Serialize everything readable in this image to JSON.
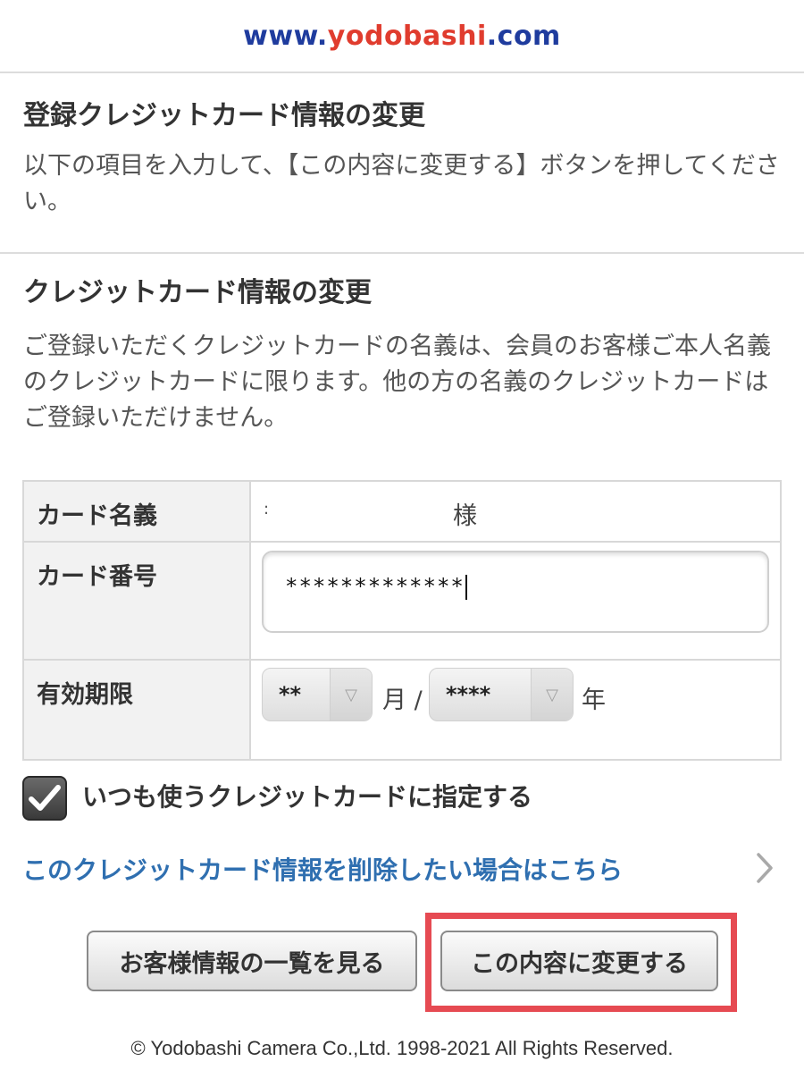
{
  "header": {
    "logo_www": "www.",
    "logo_brand": "yodobashi",
    "logo_com": ".com"
  },
  "page": {
    "title": "登録クレジットカード情報の変更",
    "instruction": "以下の項目を入力して、【この内容に変更する】ボタンを押してください。"
  },
  "section": {
    "title": "クレジットカード情報の変更",
    "notice": "ご登録いただくクレジットカードの名義は、会員のお客様ご本人名義のクレジットカードに限ります。他の方の名義のクレジットカードはご登録いただけません。"
  },
  "form": {
    "card_holder_label": "カード名義",
    "card_holder_colon": ":",
    "card_holder_suffix": "様",
    "card_number_label": "カード番号",
    "card_number_value": "*************",
    "expiry_label": "有効期限",
    "expiry_month_value": "**",
    "expiry_month_unit": "月 /",
    "expiry_year_value": "****",
    "expiry_year_unit": "年"
  },
  "default_card": {
    "label": "いつも使うクレジットカードに指定する",
    "checked": true
  },
  "delete_link": "このクレジットカード情報を削除したい場合はこちら",
  "buttons": {
    "list_label": "お客様情報の一覧を見る",
    "change_label": "この内容に変更する"
  },
  "highlight_color": "#e64a52",
  "footer": "© Yodobashi Camera Co.,Ltd. 1998-2021 All Rights Reserved."
}
